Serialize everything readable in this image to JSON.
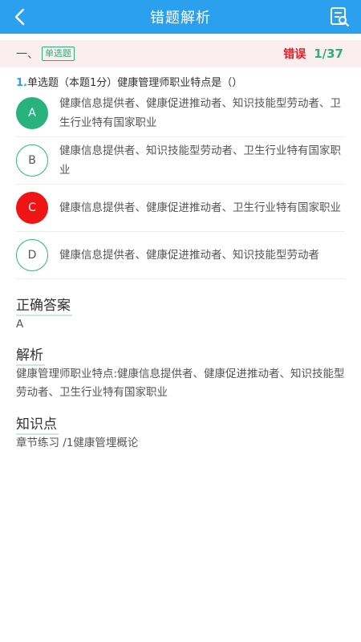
{
  "header": {
    "title": "错题解析",
    "back_icon": "chevron-left-icon",
    "menu_icon": "answer-sheet-icon"
  },
  "subbar": {
    "section_label": "一、",
    "type_badge": "单选题",
    "status": "错误",
    "progress": "1/37"
  },
  "question": {
    "number": "1.",
    "text": "单选题（本题1分）健康管理师职业特点是（）"
  },
  "options": [
    {
      "letter": "A",
      "state": "correct",
      "text": "健康信息提供者、健康促进推动者、知识技能型劳动者、卫生行业特有国家职业"
    },
    {
      "letter": "B",
      "state": "plain",
      "text": "健康信息提供者、知识技能型劳动者、卫生行业特有国家职业"
    },
    {
      "letter": "C",
      "state": "wrong",
      "text": "健康信息提供者、健康促进推动者、卫生行业特有国家职业"
    },
    {
      "letter": "D",
      "state": "plain",
      "text": "健康信息提供者、健康促进推动者、知识技能型劳动者"
    }
  ],
  "answer": {
    "heading": "正确答案",
    "value": "A"
  },
  "analysis": {
    "heading": "解析",
    "text": "健康管理师职业特点:健康信息提供者、健康促进推动者、知识技能型劳动者、卫生行业特有国家职业"
  },
  "knowledge": {
    "heading": "知识点",
    "text": "章节练习 /1健康管埋概论"
  },
  "colors": {
    "primary": "#2aa0ee",
    "correct": "#28b27e",
    "wrong": "#f01515",
    "subbar_bg": "#fbeeee"
  }
}
